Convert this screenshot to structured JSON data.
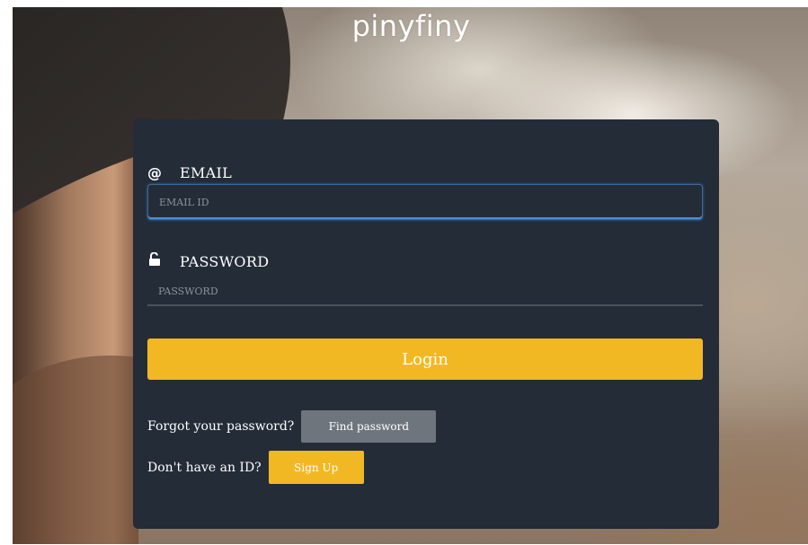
{
  "brand": {
    "title": "pinyfiny"
  },
  "login_form": {
    "email": {
      "label": "EMAIL",
      "icon": "at-sign-icon",
      "placeholder": "EMAIL ID",
      "value": ""
    },
    "password": {
      "label": "PASSWORD",
      "icon": "unlock-icon",
      "placeholder": "PASSWORD",
      "value": ""
    },
    "login_label": "Login",
    "forgot_prompt": "Forgot your password?",
    "find_password_label": "Find password",
    "signup_prompt": "Don't have an ID?",
    "signup_label": "Sign Up"
  },
  "colors": {
    "panel": "#232c37",
    "accent": "#f2b824",
    "secondary_button": "#6f757d",
    "focus_border": "#4a90d9"
  }
}
